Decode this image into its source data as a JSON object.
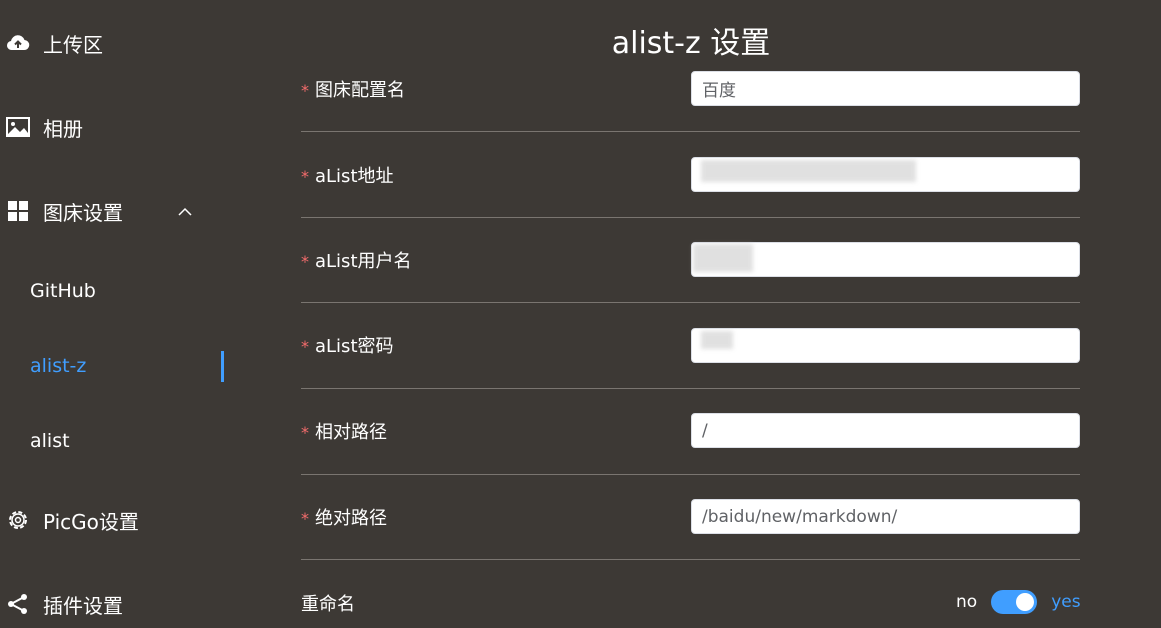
{
  "sidebar": {
    "items": [
      {
        "label": "上传区",
        "icon": "upload-cloud-icon"
      },
      {
        "label": "相册",
        "icon": "image-icon"
      },
      {
        "label": "图床设置",
        "icon": "grid-icon"
      },
      {
        "label": "PicGo设置",
        "icon": "gear-icon"
      },
      {
        "label": "插件设置",
        "icon": "share-icon"
      }
    ],
    "sub_items": [
      {
        "label": "GitHub"
      },
      {
        "label": "alist-z"
      },
      {
        "label": "alist"
      }
    ],
    "active_sub": "alist-z"
  },
  "main": {
    "title": "alist-z 设置",
    "required_mark": "*",
    "fields": [
      {
        "label": "图床配置名",
        "value": "百度"
      },
      {
        "label": "aList地址",
        "value": ""
      },
      {
        "label": "aList用户名",
        "value": ""
      },
      {
        "label": "aList密码",
        "value": ""
      },
      {
        "label": "相对路径",
        "value": "/"
      },
      {
        "label": "绝对路径",
        "value": "/baidu/new/markdown/"
      }
    ],
    "rename": {
      "label": "重命名",
      "off_text": "no",
      "on_text": "yes",
      "on": true
    }
  },
  "colors": {
    "background": "#3d3935",
    "accent": "#409eff",
    "required": "#f56c6c"
  }
}
